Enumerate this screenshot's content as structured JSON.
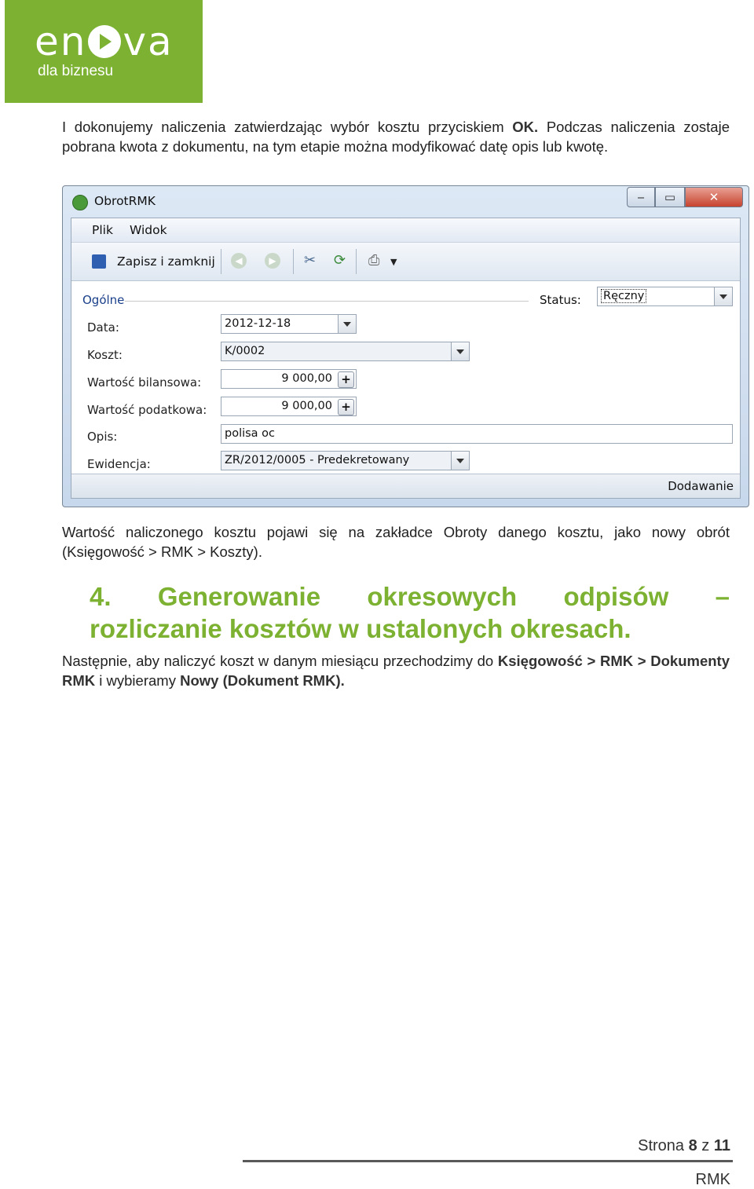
{
  "logo": {
    "word_pre": "en",
    "word_post": "va",
    "subtitle": "dla biznesu"
  },
  "para1": {
    "t1": "I dokonujemy naliczenia zatwierdzając wybór kosztu przyciskiem ",
    "b1": "OK.",
    "t2": " Podczas naliczenia zostaje pobrana kwota z dokumentu, na tym etapie można modyfikować datę opis lub kwotę."
  },
  "window": {
    "title": "ObrotRMK",
    "controls": {
      "minimize": "‒",
      "maximize": "▭",
      "close": "✕"
    },
    "menu": [
      "Plik",
      "Widok"
    ],
    "toolbar": {
      "save_label": "Zapisz i zamknij"
    },
    "section": "Ogólne",
    "status_label": "Status:",
    "status_value": "Ręczny",
    "labels": {
      "data": "Data:",
      "koszt": "Koszt:",
      "wb": "Wartość bilansowa:",
      "wp": "Wartość podatkowa:",
      "opis": "Opis:",
      "ewidencja": "Ewidencja:"
    },
    "values": {
      "data": "2012-12-18",
      "koszt": "K/0002",
      "wb": "9 000,00",
      "wp": "9 000,00",
      "opis": "polisa oc",
      "ewidencja": "ZR/2012/0005 - Predekretowany"
    },
    "plus": "+",
    "footer": "Dodawanie"
  },
  "para2": "Wartość naliczonego kosztu pojawi się na zakładce Obroty danego kosztu, jako nowy obrót (Księgowość > RMK > Koszty).",
  "heading": {
    "w1": "4.",
    "w2": "Generowanie",
    "w3": "okresowych",
    "w4": "odpisów",
    "w5": "–",
    "line2": "rozliczanie kosztów w ustalonych okresach."
  },
  "para3": {
    "t1": "Następnie, aby naliczyć koszt w danym miesiącu przechodzimy do ",
    "b1": "Księgowość > RMK > Dokumenty RMK",
    "t2": " i wybieramy ",
    "b2": "Nowy (Dokument RMK)."
  },
  "footer": {
    "strona": "Strona ",
    "page": "8",
    "z": " z ",
    "total": "11",
    "code": "RMK"
  }
}
